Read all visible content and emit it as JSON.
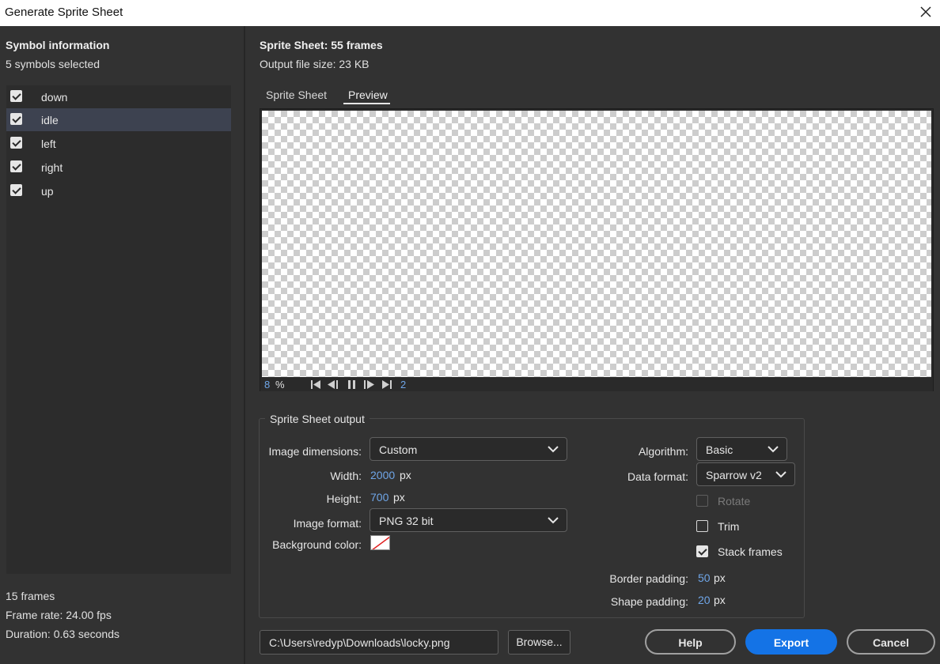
{
  "window": {
    "title": "Generate Sprite Sheet"
  },
  "symbol_info": {
    "heading": "Symbol information",
    "selected_count": "5 symbols selected",
    "symbols": [
      {
        "label": "down",
        "checked": true,
        "selected": false
      },
      {
        "label": "idle",
        "checked": true,
        "selected": true
      },
      {
        "label": "left",
        "checked": true,
        "selected": false
      },
      {
        "label": "right",
        "checked": true,
        "selected": false
      },
      {
        "label": "up",
        "checked": true,
        "selected": false
      }
    ],
    "frames": "15 frames",
    "frame_rate": "Frame rate: 24.00 fps",
    "duration": "Duration: 0.63 seconds"
  },
  "sheet": {
    "heading": "Sprite Sheet: 55 frames",
    "file_size": "Output file size: 23 KB"
  },
  "tabs": [
    {
      "label": "Sprite Sheet",
      "active": false
    },
    {
      "label": "Preview",
      "active": true
    }
  ],
  "preview": {
    "zoom": "8",
    "zoom_unit": "%",
    "frame": "2",
    "controls": [
      "first-frame-icon",
      "step-back-icon",
      "pause-icon",
      "step-forward-icon",
      "last-frame-icon"
    ]
  },
  "output": {
    "group_title": "Sprite Sheet output",
    "image_dimensions_label": "Image dimensions:",
    "image_dimensions_value": "Custom",
    "width_label": "Width:",
    "width_value": "2000",
    "height_label": "Height:",
    "height_value": "700",
    "px": "px",
    "image_format_label": "Image format:",
    "image_format_value": "PNG 32 bit",
    "background_color_label": "Background color:",
    "algorithm_label": "Algorithm:",
    "algorithm_value": "Basic",
    "data_format_label": "Data format:",
    "data_format_value": "Sparrow v2",
    "rotate_label": "Rotate",
    "rotate_checked": false,
    "rotate_enabled": false,
    "trim_label": "Trim",
    "trim_checked": false,
    "stack_label": "Stack frames",
    "stack_checked": true,
    "border_padding_label": "Border padding:",
    "border_padding_value": "50",
    "shape_padding_label": "Shape padding:",
    "shape_padding_value": "20"
  },
  "footer": {
    "path": "C:\\Users\\redyp\\Downloads\\locky.png",
    "browse_label": "Browse...",
    "help_label": "Help",
    "export_label": "Export",
    "cancel_label": "Cancel"
  },
  "colors": {
    "accent": "#1473e6",
    "value_text": "#6fa6e8",
    "panel": "#323232"
  }
}
